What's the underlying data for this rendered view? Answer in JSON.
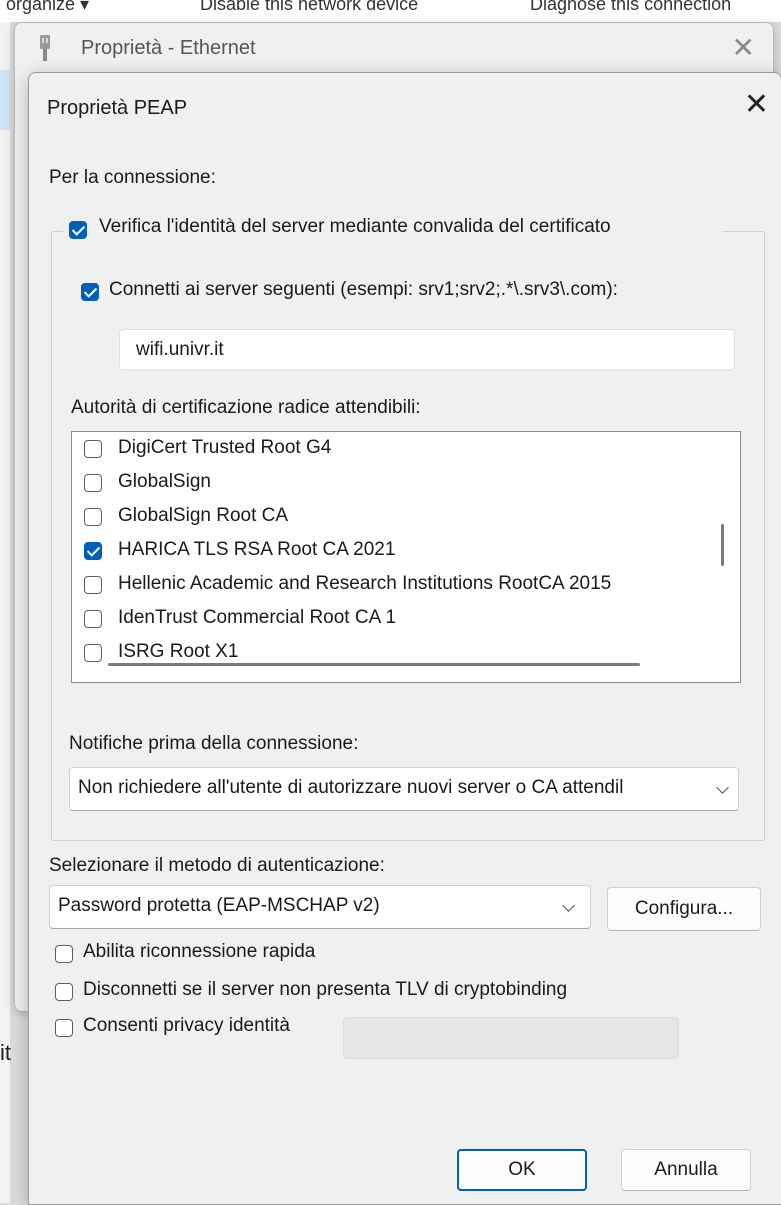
{
  "background": {
    "strip_texts": [
      "organize ▾",
      "Disable this network device",
      "Diagnose this connection"
    ],
    "side_letter": "it"
  },
  "ethernet_window": {
    "title": "Proprietà - Ethernet",
    "icon": "network-adapter-icon",
    "close": "✕"
  },
  "peap_dialog": {
    "title": "Proprietà PEAP",
    "close": "✕",
    "connection_label": "Per la connessione:",
    "verify_server_label": "Verifica l'identità del server mediante convalida del certificato",
    "verify_server_checked": true,
    "connect_servers_label": "Connetti ai server seguenti (esempi: srv1;srv2;.*\\.srv3\\.com):",
    "connect_servers_checked": true,
    "servers_value": "wifi.univr.it",
    "trusted_ca_label": "Autorità di certificazione radice attendibili:",
    "ca_list": [
      {
        "label": "DigiCert Trusted Root G4",
        "checked": false
      },
      {
        "label": "GlobalSign",
        "checked": false
      },
      {
        "label": "GlobalSign Root CA",
        "checked": false
      },
      {
        "label": "HARICA TLS RSA Root CA 2021",
        "checked": true
      },
      {
        "label": "Hellenic Academic and Research Institutions RootCA 2015",
        "checked": false
      },
      {
        "label": "IdenTrust Commercial Root CA 1",
        "checked": false
      },
      {
        "label": "ISRG Root X1",
        "checked": false
      }
    ],
    "notifications_label": "Notifiche prima della connessione:",
    "notifications_value": "Non richiedere all'utente di autorizzare nuovi server o CA attendil",
    "auth_method_label": "Selezionare il metodo di autenticazione:",
    "auth_method_value": "Password protetta (EAP-MSCHAP v2)",
    "configure_button": "Configura...",
    "fast_reconnect_label": "Abilita riconnessione rapida",
    "fast_reconnect_checked": false,
    "disconnect_tlv_label": "Disconnetti se il server non presenta TLV di cryptobinding",
    "disconnect_tlv_checked": false,
    "identity_privacy_label": "Consenti privacy identità",
    "identity_privacy_checked": false,
    "ok_button": "OK",
    "cancel_button": "Annulla"
  },
  "colors": {
    "accent": "#005fb8",
    "dialog_bg": "#f0f0f0"
  }
}
